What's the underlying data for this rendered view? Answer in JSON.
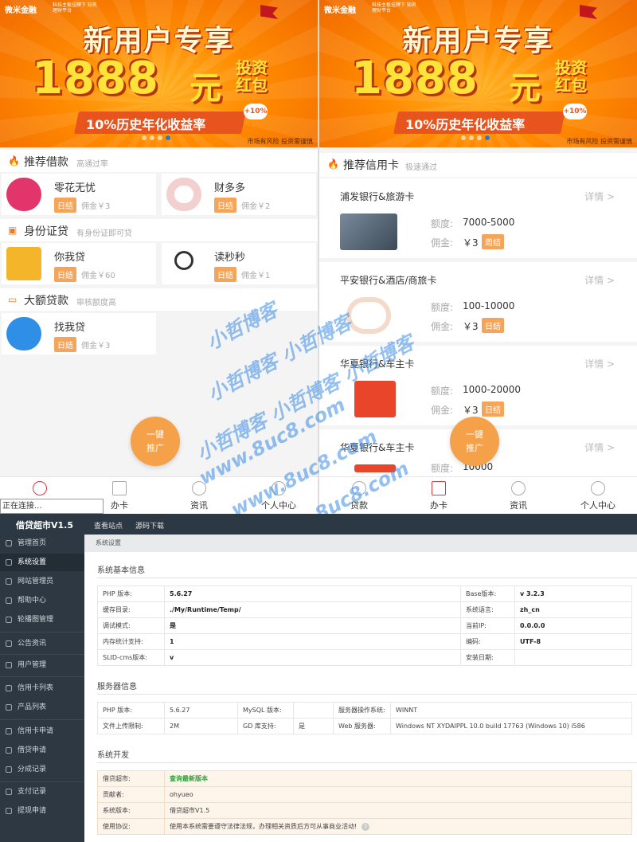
{
  "banner": {
    "logo": "微米金融",
    "logo_sub": "科技主板挂牌下 知名理财平台",
    "title": "新用户专享",
    "amount": "1888",
    "unit": "元",
    "tag": "投资红包",
    "rate": "10%历史年化收益率",
    "rate_plus": "+10%",
    "risk": "市场有风险 投资需谨慎"
  },
  "left": {
    "sections": [
      {
        "title": "推荐借款",
        "subtitle": "高通过率"
      },
      {
        "title": "身份证贷",
        "subtitle": "有身份证即可贷"
      },
      {
        "title": "大额贷款",
        "subtitle": "审核额度高"
      }
    ],
    "cards": [
      {
        "name": "零花无忧",
        "tag": "日结",
        "fee": "佣金￥3"
      },
      {
        "name": "财多多",
        "tag": "日结",
        "fee": "佣金￥2"
      },
      {
        "name": "你我贷",
        "tag": "日结",
        "fee": "佣金￥60"
      },
      {
        "name": "读秒秒",
        "tag": "日结",
        "fee": "佣金￥1"
      },
      {
        "name": "找我贷",
        "tag": "日结",
        "fee": "佣金￥3"
      }
    ],
    "fab": [
      "一键",
      "推广"
    ],
    "status": "正在连接...",
    "tabs": [
      "贷款",
      "办卡",
      "资讯",
      "个人中心"
    ]
  },
  "right": {
    "section": {
      "title": "推荐信用卡",
      "subtitle": "极速通过"
    },
    "detail_label": "详情 >",
    "limit_label": "额度:",
    "fee_label": "佣金:",
    "cards": [
      {
        "name": "浦发银行&旅游卡",
        "limit": "7000-5000",
        "fee": "￥3",
        "tag": "周结"
      },
      {
        "name": "平安银行&酒店/商旅卡",
        "limit": "100-10000",
        "fee": "￥3",
        "tag": "日结"
      },
      {
        "name": "华夏银行&车主卡",
        "limit": "1000-20000",
        "fee": "￥3",
        "tag": "日结"
      },
      {
        "name": "华夏银行&车主卡",
        "limit": "10000",
        "fee": "",
        "tag": ""
      }
    ],
    "fab": [
      "一键",
      "推广"
    ],
    "tabs": [
      "贷款",
      "办卡",
      "资讯",
      "个人中心"
    ]
  },
  "watermark": {
    "line1": "小哲博客",
    "line2": "小哲博客 小哲博客",
    "line3": "小哲博客 小哲博客 小哲博客",
    "url1": "www.8uc8.com",
    "url2": "www.8uc8.com",
    "url3": "www.8uc8.com"
  },
  "admin": {
    "brand": "借贷超市V1.5",
    "top_links": [
      "查看站点",
      "源码下载"
    ],
    "sidebar": [
      "管理首页",
      "系统设置",
      "网站管理员",
      "帮助中心",
      "轮播图管理",
      "公告资讯",
      "用户管理",
      "信用卡列表",
      "产品列表",
      "信用卡申请",
      "借贷申请",
      "分成记录",
      "支付记录",
      "提现申请"
    ],
    "breadcrumb": "系统设置",
    "basic_title": "系统基本信息",
    "basic_rows": [
      [
        "PHP 版本:",
        "5.6.27",
        "Base版本:",
        "v 3.2.3"
      ],
      [
        "缓存目录:",
        "./My/Runtime/Temp/",
        "系统语言:",
        "zh_cn"
      ],
      [
        "调试模式:",
        "是",
        "当前IP:",
        "0.0.0.0"
      ],
      [
        "内存统计支持:",
        "1",
        "编码:",
        "UTF-8"
      ],
      [
        "SLID-cms版本:",
        "v",
        "安装日期:",
        ""
      ]
    ],
    "server_title": "服务器信息",
    "server_rows": [
      [
        "PHP 版本:",
        "5.6.27",
        "MySQL 版本:",
        "",
        "服务器操作系统:",
        "WINNT"
      ],
      [
        "文件上传限制:",
        "2M",
        "GD 库支持:",
        "是",
        "Web 服务器:",
        "Windows NT XYDAIPPL 10.0 build 17763 (Windows 10) i586"
      ]
    ],
    "dev_title": "系统开发",
    "dev_rows": [
      [
        "借贷超市:",
        "查询最新版本"
      ],
      [
        "贡献者:",
        "ohyueo"
      ],
      [
        "系统版本:",
        "借贷超市V1.5"
      ],
      [
        "使用协议:",
        "使用本系统需要遵守法律法规，办理相关资质后方可从事商业活动!"
      ]
    ]
  }
}
